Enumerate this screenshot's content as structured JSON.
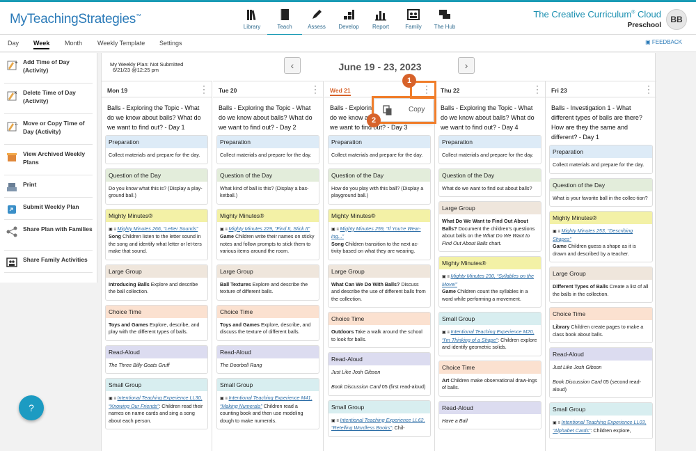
{
  "app": {
    "logo": "MyTeachingStrategies",
    "brand": "The Creative Curriculum",
    "brand2": "Cloud",
    "program": "Preschool",
    "avatar": "BB"
  },
  "nav": [
    {
      "label": "Library",
      "icon": "library-icon"
    },
    {
      "label": "Teach",
      "icon": "book-icon"
    },
    {
      "label": "Assess",
      "icon": "pencil-icon"
    },
    {
      "label": "Develop",
      "icon": "blocks-icon"
    },
    {
      "label": "Report",
      "icon": "bar-chart-icon"
    },
    {
      "label": "Family",
      "icon": "family-icon"
    },
    {
      "label": "The Hub",
      "icon": "chat-icon"
    }
  ],
  "tabs": [
    "Day",
    "Week",
    "Month",
    "Weekly Template",
    "Settings"
  ],
  "feedback": "FEEDBACK",
  "sidebar": [
    {
      "label": "Add Time of Day (Activity)",
      "icon": "add-time-icon"
    },
    {
      "label": "Delete Time of Day (Activity)",
      "icon": "delete-time-icon"
    },
    {
      "label": "Move or Copy Time of Day (Activity)",
      "icon": "move-time-icon"
    },
    {
      "label": "View Archived Weekly Plans",
      "icon": "archive-icon"
    },
    {
      "label": "Print",
      "icon": "print-icon"
    },
    {
      "label": "Submit Weekly Plan",
      "icon": "submit-icon"
    },
    {
      "label": "Share Plan with Families",
      "icon": "share-icon"
    },
    {
      "label": "Share Family Activities",
      "icon": "family-activities-icon"
    }
  ],
  "help": "?",
  "plan": {
    "status": "My Weekly Plan: Not Submitted",
    "date": "6/21/23 @12:25 pm",
    "range": "June 19 - 23, 2023",
    "prev": "‹",
    "next": "›"
  },
  "popup": {
    "copy": "Copy",
    "badge1": "1",
    "badge2": "2"
  },
  "days": [
    {
      "day": "Mon 19",
      "title": "Balls - Exploring the Topic - What do we know about balls? What do we want to find out? - Day 1",
      "cards": [
        {
          "type": "prep",
          "h": "Preparation",
          "b": "Collect materials and prepare for the day."
        },
        {
          "type": "qod",
          "h": "Question of the Day",
          "b": "Do you know what this is? (Display a play-ground ball.)"
        },
        {
          "type": "mm",
          "h": "Mighty Minutes®",
          "link": "Mighty Minutes 266, “Letter Sounds”",
          "bold": "Song",
          "b": "Children listen to the letter sound in the song and identify what letter or let-ters make that sound."
        },
        {
          "type": "lg",
          "h": "Large Group",
          "bold": "Introducing Balls",
          "b": "Explore and describe the ball collection."
        },
        {
          "type": "cht",
          "h": "Choice Time",
          "bold": "Toys and Games",
          "b": "Explore, describe, and play with the different types of balls."
        },
        {
          "type": "ra",
          "h": "Read-Aloud",
          "ital": "The Three Billy Goats Gruff"
        },
        {
          "type": "sg",
          "h": "Small Group",
          "link": "Intentional Teaching Experience LL30, “Knowing Our Friends”",
          "b": ": Children read their names on name cards and sing a song about each person."
        }
      ]
    },
    {
      "day": "Tue 20",
      "title": "Balls - Exploring the Topic - What do we know about balls? What do we want to find out? - Day 2",
      "cards": [
        {
          "type": "prep",
          "h": "Preparation",
          "b": "Collect materials and prepare for the day."
        },
        {
          "type": "qod",
          "h": "Question of the Day",
          "b": "What kind of ball is this? (Display a bas-ketball.)"
        },
        {
          "type": "mm",
          "h": "Mighty Minutes®",
          "link": "Mighty Minutes 229, “Find It, Stick It”",
          "bold": "Game",
          "b": "Children write their names on sticky notes and follow prompts to stick them to various items around the room."
        },
        {
          "type": "lg",
          "h": "Large Group",
          "bold": "Ball Textures",
          "b": "Explore and describe the texture of different balls."
        },
        {
          "type": "cht",
          "h": "Choice Time",
          "bold": "Toys and Games",
          "b": "Explore, describe, and discuss the texture of different balls."
        },
        {
          "type": "ra",
          "h": "Read-Aloud",
          "ital": "The Doorbell Rang"
        },
        {
          "type": "sg",
          "h": "Small Group",
          "link": "Intentional Teaching Experience M41, “Making Numerals”",
          "b": " Children read a counting book and then use modeling dough to make numerals."
        }
      ]
    },
    {
      "day": "Wed 21",
      "title": "Balls - Exploring the Topic - What do we know about balls? What do we want to find out? - Day 3",
      "cards": [
        {
          "type": "prep",
          "h": "Preparation",
          "b": "Collect materials and prepare for the day."
        },
        {
          "type": "qod",
          "h": "Question of the Day",
          "b": "How do you play with this ball? (Display a playground ball.)"
        },
        {
          "type": "mm",
          "h": "Mighty Minutes®",
          "link": "Mighty Minutes 259, “If You're Wear-ing...”",
          "bold": "Song",
          "b": "Children transition to the next ac-tivity based on what they are wearing."
        },
        {
          "type": "lg",
          "h": "Large Group",
          "bold": "What Can We Do With Balls?",
          "b": "Discuss and describe the use of different balls from the collection."
        },
        {
          "type": "cht",
          "h": "Choice Time",
          "bold": "Outdoors",
          "b": "Take a walk around the school to look for balls."
        },
        {
          "type": "ra",
          "h": "Read-Aloud",
          "ital": "Just Like Josh Gibson",
          "b2": "Book Discussion Card",
          "b3": "05 (first read-aloud)"
        },
        {
          "type": "sg",
          "h": "Small Group",
          "link": "Intentional Teaching Experience LL62, “Retelling Wordless Books”",
          "b": ": Chil-"
        }
      ]
    },
    {
      "day": "Thu 22",
      "title": "Balls - Exploring the Topic - What do we know about balls? What do we want to find out? - Day 4",
      "cards": [
        {
          "type": "prep",
          "h": "Preparation",
          "b": "Collect materials and prepare for the day."
        },
        {
          "type": "qod",
          "h": "Question of the Day",
          "b": "What do we want to find out about balls?"
        },
        {
          "type": "lg",
          "h": "Large Group",
          "bold": "What Do We Want to Find Out About Balls?",
          "b": "Document the children's questions about balls on the",
          "ital2": "What Do We Want to Find Out About Balls",
          "b4": "chart."
        },
        {
          "type": "mm",
          "h": "Mighty Minutes®",
          "link": "Mighty Minutes 230, “Syllables on the Move!”",
          "bold": "Game",
          "b": "Children count the syllables in a word while performing a movement."
        },
        {
          "type": "sg",
          "h": "Small Group",
          "link": "Intentional Teaching Experience M20, “I'm Thinking of a Shape”",
          "b": ": Children explore and identify geometric solids."
        },
        {
          "type": "cht",
          "h": "Choice Time",
          "bold": "Art",
          "b": "Children make observational draw-ings of balls."
        },
        {
          "type": "ra",
          "h": "Read-Aloud",
          "ital": "Have a Ball"
        }
      ]
    },
    {
      "day": "Fri 23",
      "title": "Balls - Investigation 1 - What different types of balls are there? How are they the same and different? - Day 1",
      "cards": [
        {
          "type": "prep",
          "h": "Preparation",
          "b": "Collect materials and prepare for the day."
        },
        {
          "type": "qod",
          "h": "Question of the Day",
          "b": "What is your favorite ball in the collec-tion?"
        },
        {
          "type": "mm",
          "h": "Mighty Minutes®",
          "link": "Mighty Minutes 253, “Describing Shapes”",
          "bold": "Game",
          "b": "Children guess a shape as it is drawn and described by a teacher."
        },
        {
          "type": "lg",
          "h": "Large Group",
          "bold": "Different Types of Balls",
          "b": "Create a list of all the balls in the collection."
        },
        {
          "type": "cht",
          "h": "Choice Time",
          "bold": "Library",
          "b": "Children create pages to make a class book about balls."
        },
        {
          "type": "ra",
          "h": "Read-Aloud",
          "ital": "Just Like Josh Gibson",
          "b2": "Book Discussion Card",
          "b3": "05 (second read-aloud)"
        },
        {
          "type": "sg",
          "h": "Small Group",
          "link": "Intentional Teaching Experience LL03, “Alphabet Cards”",
          "b": ": Children explore,"
        }
      ]
    }
  ]
}
